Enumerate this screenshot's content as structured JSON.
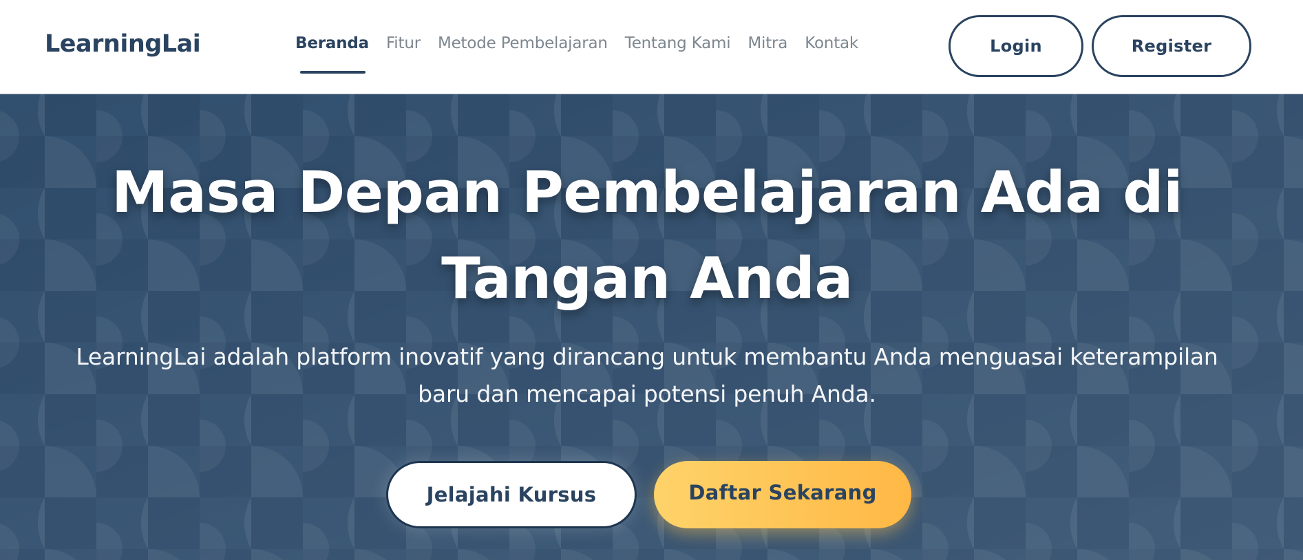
{
  "navbar": {
    "brand": "LearningLai",
    "links": [
      {
        "label": "Beranda",
        "active": true
      },
      {
        "label": "Fitur",
        "active": false
      },
      {
        "label": "Metode Pembelajaran",
        "active": false
      },
      {
        "label": "Tentang Kami",
        "active": false
      },
      {
        "label": "Mitra",
        "active": false
      },
      {
        "label": "Kontak",
        "active": false
      }
    ],
    "login_label": "Login",
    "register_label": "Register"
  },
  "hero": {
    "title": "Masa Depan Pembelajaran Ada di Tangan Anda",
    "description": "LearningLai adalah platform inovatif yang dirancang untuk membantu Anda menguasai keterampilan baru dan mencapai potensi penuh Anda.",
    "explore_label": "Jelajahi Kursus",
    "signup_label": "Daftar Sekarang"
  },
  "colors": {
    "primary": "#2a4360",
    "hero_background": "#2d4a69",
    "accent": "#ffc45a",
    "muted_text": "#7d8790"
  }
}
